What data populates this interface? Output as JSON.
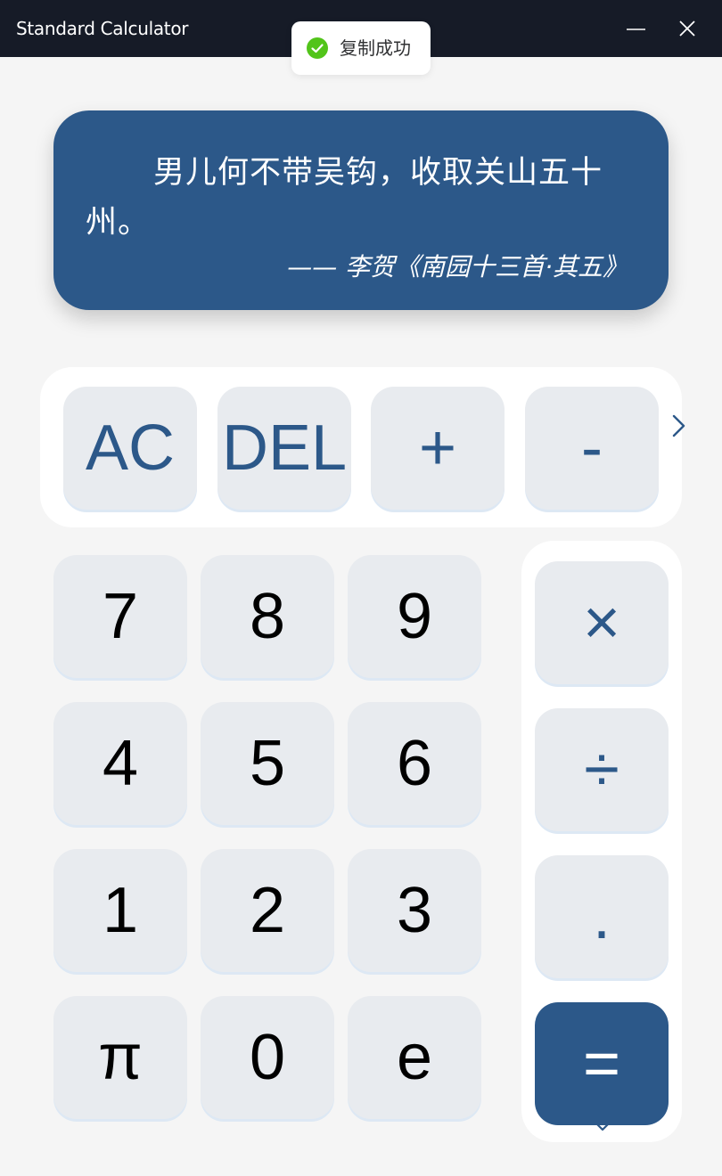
{
  "window": {
    "title": "Standard Calculator",
    "minimize_icon": "minimize-icon",
    "close_icon": "close-icon"
  },
  "toast": {
    "icon": "check-circle-icon",
    "color": "#52c41a",
    "message": "复制成功"
  },
  "quote": {
    "text": "男儿何不带吴钩，收取关山五十州。",
    "author": "—— 李贺《南园十三首·其五》",
    "background": "#2c5889"
  },
  "top_keys": [
    "AC",
    "DEL",
    "+",
    "-"
  ],
  "number_keys": [
    [
      "7",
      "8",
      "9"
    ],
    [
      "4",
      "5",
      "6"
    ],
    [
      "1",
      "2",
      "3"
    ],
    [
      "π",
      "0",
      "e"
    ]
  ],
  "side_keys": [
    "×",
    "÷",
    ".",
    "="
  ],
  "colors": {
    "titlebar": "#161b27",
    "key_bg": "#e8ebef",
    "accent": "#2c5889",
    "panel": "#ffffff",
    "background": "#f5f5f5"
  }
}
